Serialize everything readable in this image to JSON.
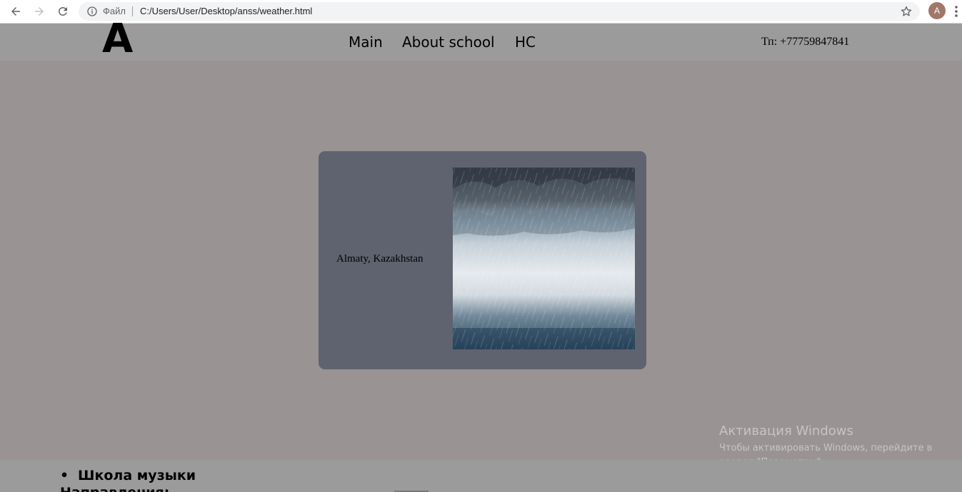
{
  "browser": {
    "scheme_label": "Файл",
    "url": "C:/Users/User/Desktop/anss/weather.html",
    "avatar_letter": "A",
    "icons": [
      "back-arrow-icon",
      "forward-arrow-icon",
      "reload-icon",
      "info-icon",
      "star-icon",
      "kebab-menu-icon"
    ]
  },
  "header": {
    "logo": "A",
    "nav": [
      "Main",
      "About school",
      "HC"
    ],
    "phone": "Тп: +77759847841"
  },
  "card": {
    "location": "Almaty, Kazakhstan",
    "image": "rain-storm-clouds"
  },
  "footer": {
    "bullet": "•",
    "item": "Школа музыки",
    "heading": "Направления:"
  },
  "watermark": {
    "title": "Активация Windows",
    "line1": "Чтобы активировать Windows, перейдите в",
    "line2": "раздел \"Параметры\"."
  },
  "colors": {
    "page_bg": "#9a9393",
    "header_bg": "#9b9b9b",
    "card_bg": "#5e636f"
  }
}
